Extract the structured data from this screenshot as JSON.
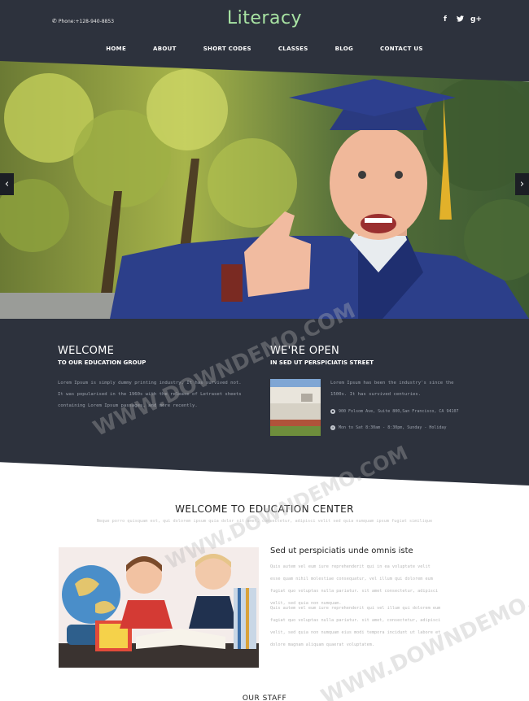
{
  "header": {
    "phone": "Phone:+128-940-8853",
    "logo": "Literacy",
    "social": [
      "f",
      "t",
      "g+"
    ],
    "nav": [
      "HOME",
      "ABOUT",
      "SHORT CODES",
      "CLASSES",
      "BLOG",
      "CONTACT US"
    ]
  },
  "hero": {
    "prev_arrow": "‹",
    "next_arrow": "›"
  },
  "welcome": {
    "title": "WELCOME",
    "subtitle": "TO OUR EDUCATION GROUP",
    "lines": [
      "Lorem Ipsum is simply dummy printing industry. It has survived not.",
      "It was popularised in the 1960s with the release of Letraset sheets",
      "containing Lorem Ipsum passages, and more recently."
    ]
  },
  "open": {
    "title": "WE'RE OPEN",
    "subtitle": "IN SED UT PERSPICIATIS STREET",
    "lines": [
      "Lorem Ipsum has been the industry's since the",
      "1500s. It has survived centuries."
    ],
    "address": "900 Folsom Ave, Suite 800,San Francisco, CA 94107",
    "hours": "Mon to Sat 8:30am - 8:30pm, Sunday - Holiday"
  },
  "center": {
    "title": "WELCOME TO EDUCATION CENTER",
    "subtitle": "Neque porro quisquam est, qui dolorem ipsum quia dolor sit amet, consectetur, adipisci velit sed quia numquam ipsum fugiat similique",
    "right_title": "Sed ut perspiciatis unde omnis iste",
    "para1": [
      "Quis autem vel eum iure reprehenderit qui in ea voluptate velit",
      "esse quam nihil molestiae consequatur, vel illum qui dolorem eum",
      "fugiat quo voluptas nulla pariatur. sit amet consectetur, adipisci",
      "velit, sed quia non numquam."
    ],
    "para2": [
      "Quis autem vel eum iure reprehenderit qui vel illum qui dolorem eum",
      "fugiat quo voluptas nulla pariatur. sit amet, consectetur, adipisci",
      "velit, sed quia non numquam eius modi tempora incidunt ut labore et",
      "dolore magnam aliquam quaerat voluptatem."
    ]
  },
  "bottom": {
    "title": "OUR STAFF"
  },
  "watermark": "WWW.DOWNDEMO.COM"
}
